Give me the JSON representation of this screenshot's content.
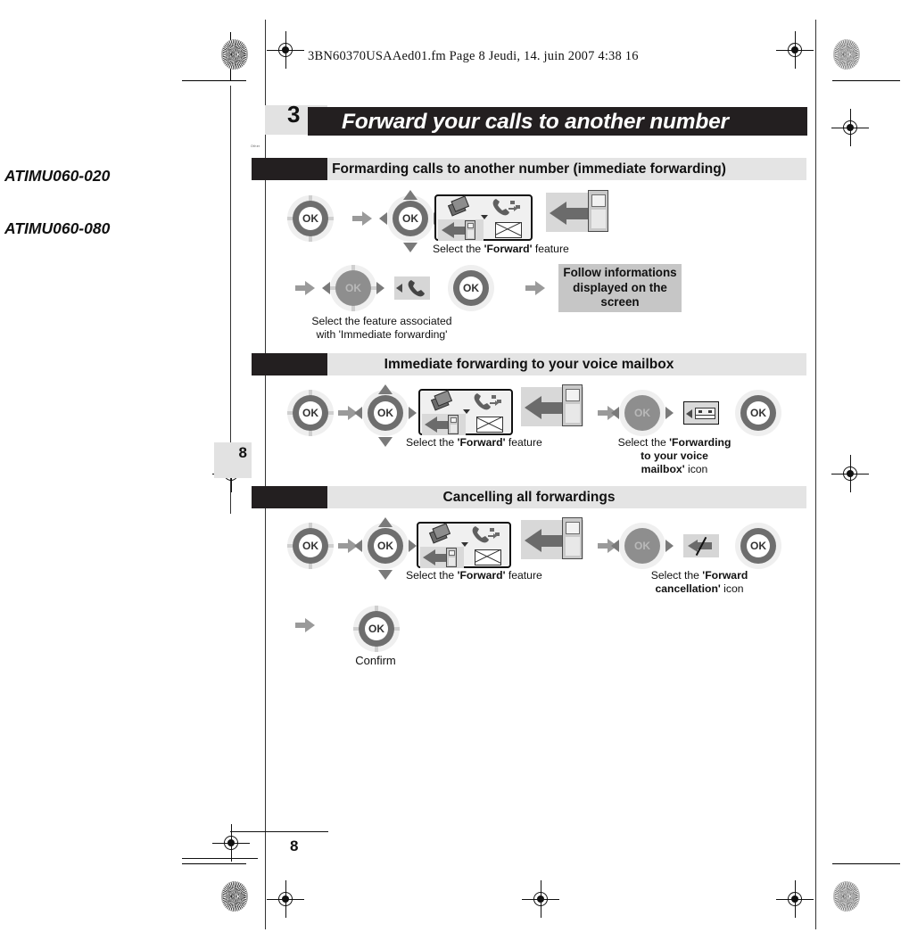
{
  "document": {
    "file_header": "3BN60370USAAed01.fm  Page 8  Jeudi, 14. juin 2007  4:38 16",
    "chapter_number": "3",
    "chapter_title": "Forward your calls to another number",
    "micro_label": "Other",
    "page_tab_number": "8",
    "folio_number": "8"
  },
  "margin_codes": [
    {
      "label": "ATIMU060-020"
    },
    {
      "label": "ATIMU060-080"
    }
  ],
  "sections": [
    {
      "id": "immediate-forwarding",
      "heading": "Formarding calls to another number (immediate forwarding)",
      "captions": {
        "select_forward_pre": "Select the ",
        "select_forward_bold": "'Forward'",
        "select_forward_post": " feature",
        "select_feature_line1": "Select the feature associated",
        "select_feature_line2": "with 'Immediate forwarding'",
        "note_line1": "Follow informations",
        "note_line2": "displayed on the",
        "note_line3": "screen"
      }
    },
    {
      "id": "voice-mailbox-forwarding",
      "heading": "Immediate forwarding to your voice mailbox",
      "captions": {
        "select_forward_pre": "Select the ",
        "select_forward_bold": "'Forward'",
        "select_forward_post": " feature",
        "select_icon_pre": "Select the ",
        "select_icon_bold_line1": "'Forwarding",
        "select_icon_bold_line2": "to your voice",
        "select_icon_bold_line3": "mailbox'",
        "select_icon_post": " icon"
      }
    },
    {
      "id": "cancel-all-forwardings",
      "heading": "Cancelling all forwardings",
      "captions": {
        "select_forward_pre": "Select the ",
        "select_forward_bold": "'Forward'",
        "select_forward_post": " feature",
        "select_icon_pre": "Select the ",
        "select_icon_bold_line1": "'Forward",
        "select_icon_bold_line2": "cancellation'",
        "select_icon_post": " icon",
        "confirm": "Confirm"
      }
    }
  ],
  "keys": {
    "ok_label": "OK"
  },
  "colors": {
    "title_bar": "#231f20",
    "section_bar": "#e4e4e4",
    "section_block": "#231f20",
    "chapter_box": "#e2e2e2",
    "note_block": "#c6c6c6",
    "nav_ring": "#6e6e6e",
    "flow_arrow": "#9a9a9a"
  }
}
